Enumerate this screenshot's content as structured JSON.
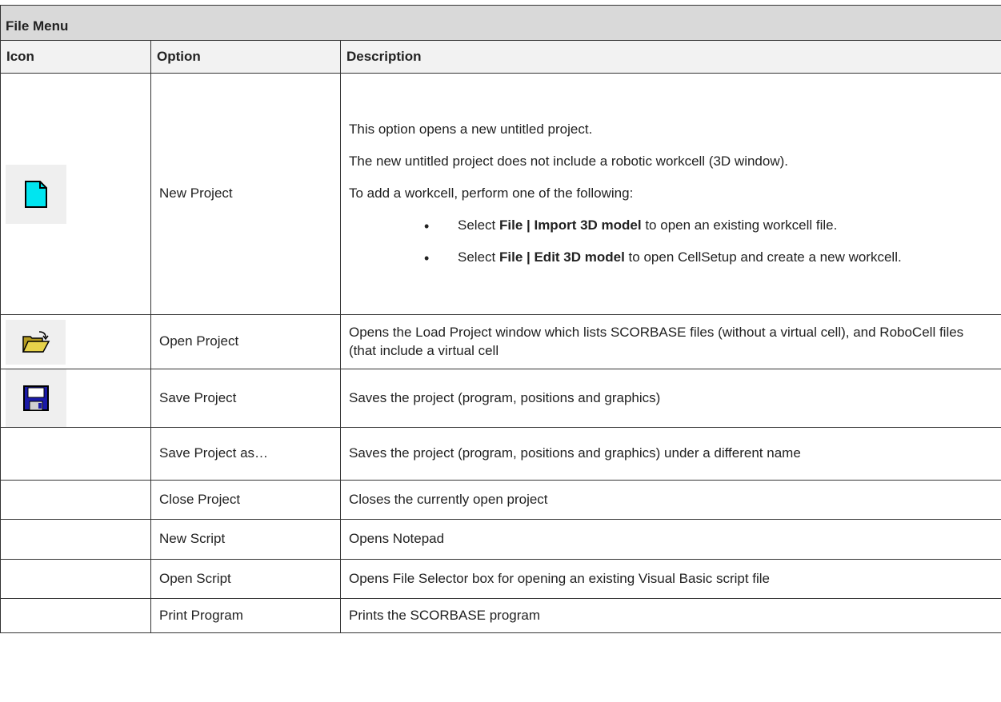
{
  "table": {
    "title": "File Menu",
    "columns": [
      "Icon",
      "Option",
      "Description"
    ],
    "rows": [
      {
        "icon": "new-file-icon",
        "option": "New Project",
        "paragraphs": [
          "This option opens a new untitled project.",
          "The new untitled project does not include a robotic workcell (3D window).",
          "To add a workcell, perform one of the following:"
        ],
        "bullets": [
          {
            "lead": "Select ",
            "bold": "File | Import 3D model",
            "rest": " to open an existing workcell file."
          },
          {
            "lead": "Select ",
            "bold": "File | Edit 3D model",
            "rest": " to open CellSetup and create a new workcell."
          }
        ]
      },
      {
        "icon": "open-folder-icon",
        "option": "Open Project",
        "description": "Opens the Load Project window which lists SCORBASE files (without a virtual cell), and RoboCell files (that include a virtual cell"
      },
      {
        "icon": "floppy-disk-icon",
        "option": "Save Project",
        "description": "Saves the project (program, positions and graphics)"
      },
      {
        "icon": "",
        "option": "Save Project as…",
        "description": "Saves the project (program, positions and graphics) under a different name"
      },
      {
        "icon": "",
        "option": "Close Project",
        "description": "Closes the currently open project"
      },
      {
        "icon": "",
        "option": "New Script",
        "description": "Opens Notepad"
      },
      {
        "icon": "",
        "option": "Open Script",
        "description": "Opens File Selector box for opening an existing Visual Basic script file"
      },
      {
        "icon": "",
        "option": "Print Program",
        "description": "Prints the SCORBASE program"
      }
    ]
  },
  "colors": {
    "title_bg": "#d9d9d9",
    "header_bg": "#f2f2f2",
    "new_icon_fill": "#00e5f0",
    "folder_fill": "#e6d24a",
    "floppy_fill": "#1a1aa8"
  }
}
